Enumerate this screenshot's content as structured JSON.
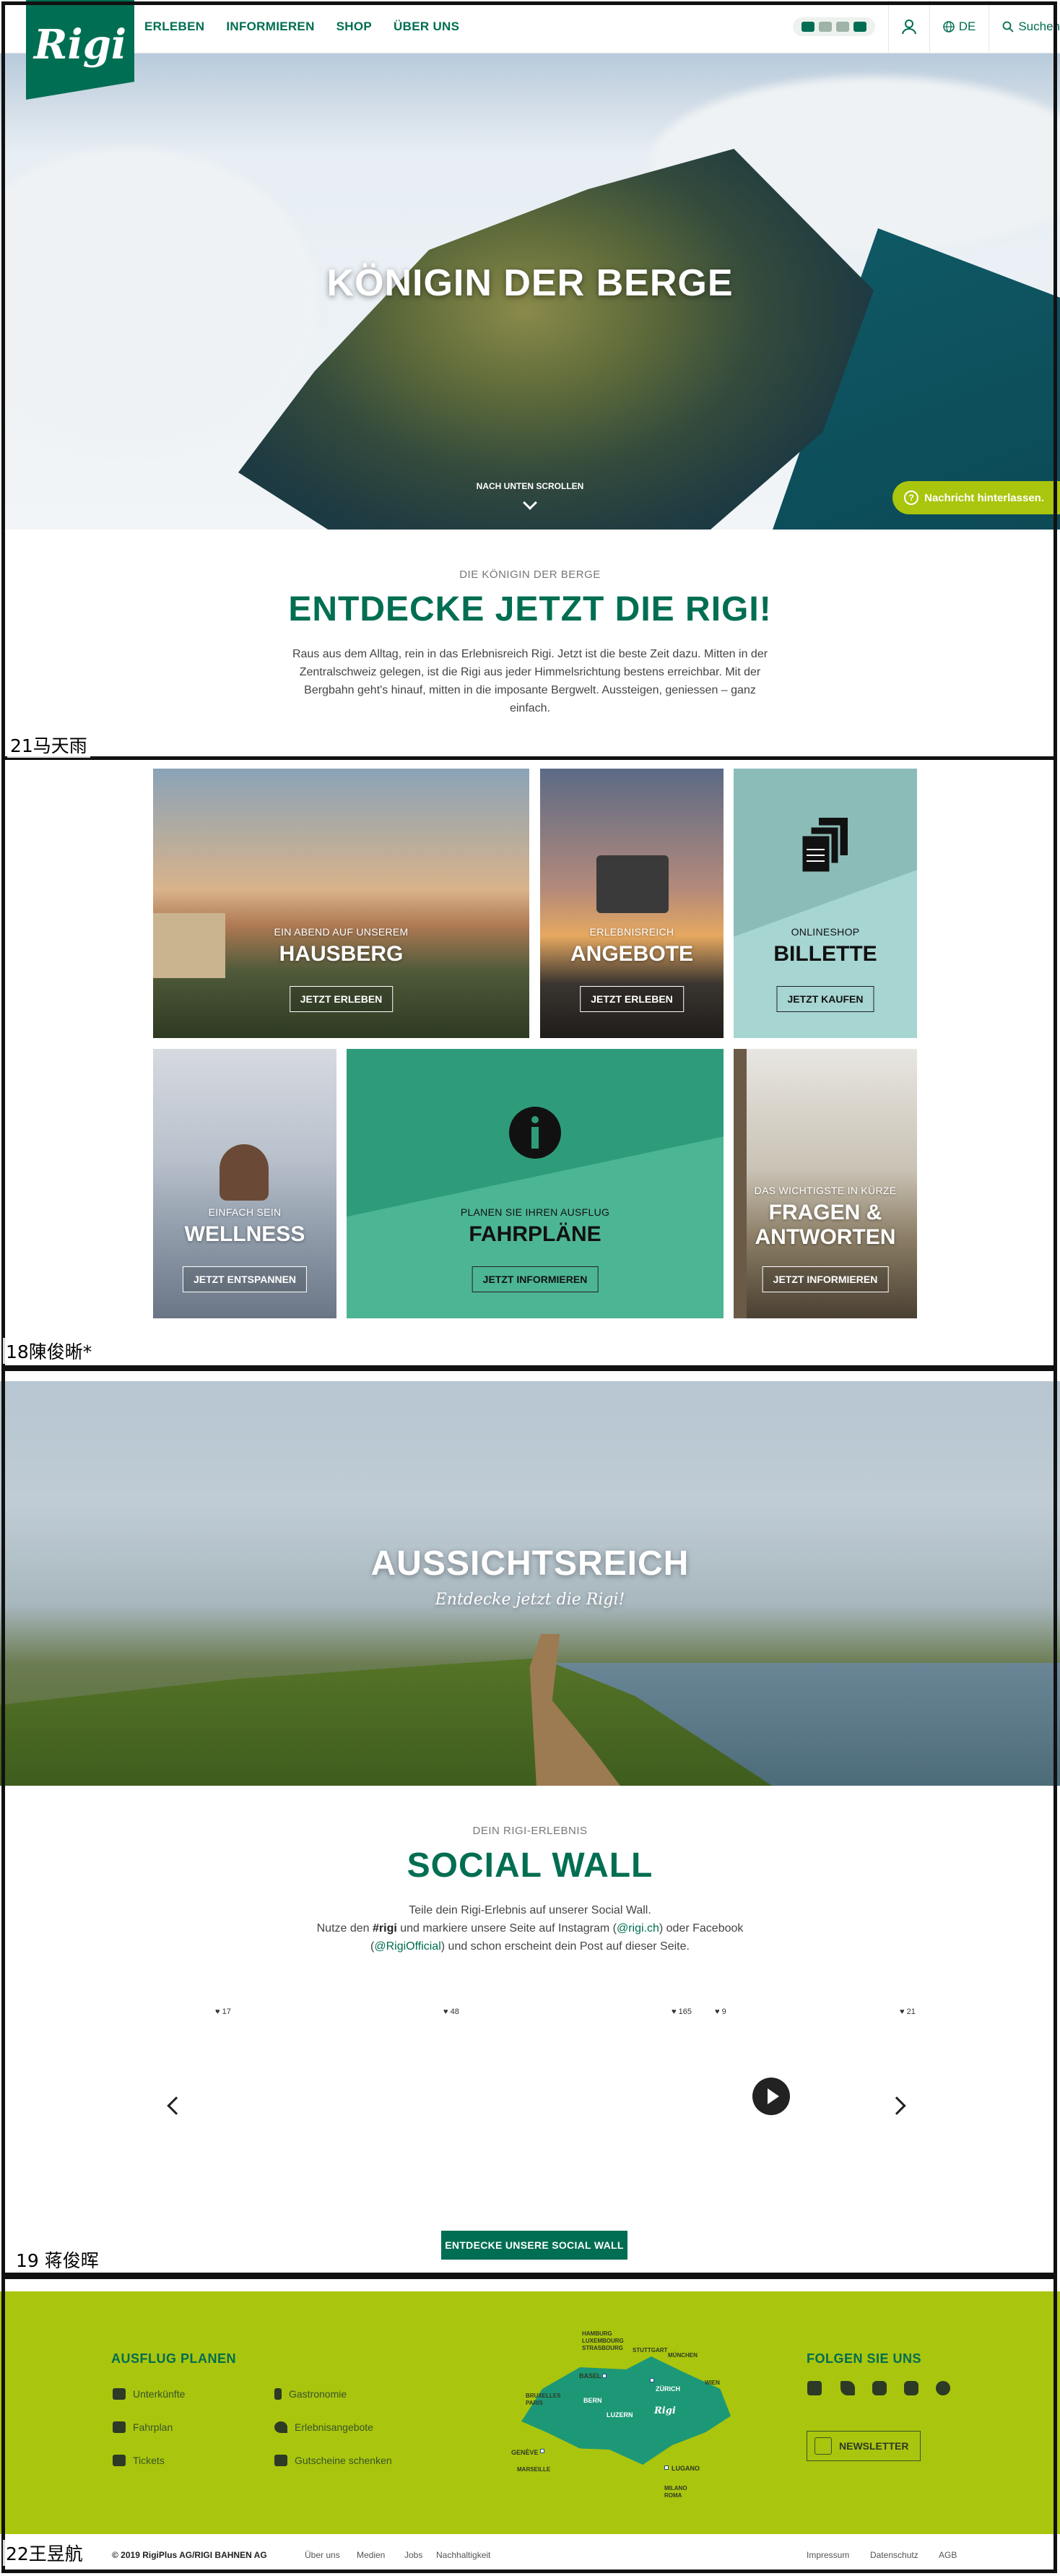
{
  "header": {
    "logo_text": "Rigi",
    "nav": [
      "ERLEBEN",
      "INFORMIEREN",
      "SHOP",
      "ÜBER UNS"
    ],
    "language": "DE",
    "search_label": "Suchen",
    "colors": {
      "brand": "#006e52",
      "lime": "#aac50d"
    }
  },
  "hero": {
    "title": "KÖNIGIN DER BERGE",
    "scroll_hint": "NACH UNTEN SCROLLEN",
    "message_button": "Nachricht hinterlassen."
  },
  "intro": {
    "eyebrow": "DIE KÖNIGIN DER BERGE",
    "title": "ENTDECKE JETZT DIE RIGI!",
    "body": "Raus aus dem Alltag, rein in das Erlebnisreich Rigi. Jetzt ist die beste Zeit dazu. Mitten in der Zentralschweiz gelegen, ist die Rigi aus jeder Himmelsrichtung bestens erreichbar. Mit der Bergbahn geht's hinauf, mitten in die imposante Bergwelt. Aussteigen, geniessen – ganz einfach."
  },
  "tiles": [
    {
      "caption": "EIN ABEND AUF UNSEREM",
      "title": "HAUSBERG",
      "button": "JETZT ERLEBEN"
    },
    {
      "caption": "ERLEBNISREICH",
      "title": "ANGEBOTE",
      "button": "JETZT ERLEBEN"
    },
    {
      "caption": "ONLINESHOP",
      "title": "BILLETTE",
      "button": "JETZT KAUFEN"
    },
    {
      "caption": "EINFACH SEIN",
      "title": "WELLNESS",
      "button": "JETZT ENTSPANNEN"
    },
    {
      "caption": "PLANEN SIE IHREN AUSFLUG",
      "title": "FAHRPLÄNE",
      "button": "JETZT INFORMIEREN"
    },
    {
      "caption": "DAS WICHTIGSTE IN KÜRZE",
      "title": "FRAGEN & ANTWORTEN",
      "button": "JETZT INFORMIEREN"
    }
  ],
  "aussicht": {
    "title": "AUSSICHTSREICH",
    "subtitle": "Entdecke jetzt die Rigi!"
  },
  "social": {
    "eyebrow": "DEIN RIGI-ERLEBNIS",
    "title": "SOCIAL WALL",
    "line1": "Teile dein Rigi-Erlebnis auf unserer Social Wall.",
    "line2_a": "Nutze den ",
    "hashtag": "#rigi",
    "line2_b": " und markiere unsere Seite auf Instagram (",
    "instagram": "@rigi.ch",
    "line2_c": ") oder Facebook",
    "line3_a": "(",
    "facebook": "@RigiOfficial",
    "line3_b": ") und schon erscheint dein Post auf dieser Seite.",
    "likes": [
      "17",
      "48",
      "165",
      "9",
      "21"
    ],
    "cta": "ENTDECKE UNSERE SOCIAL WALL"
  },
  "footer": {
    "plan_heading": "AUSFLUG PLANEN",
    "links_left": [
      "Unterkünfte",
      "Fahrplan",
      "Tickets"
    ],
    "links_right": [
      "Gastronomie",
      "Erlebnisangebote",
      "Gutscheine schenken"
    ],
    "follow_heading": "FOLGEN SIE UNS",
    "newsletter": "NEWSLETTER",
    "map_labels": {
      "hamburg": "HAMBURG",
      "luxembourg": "LUXEMBOURG",
      "strasbourg": "STRASBOURG",
      "stuttgart": "STUTTGART",
      "munchen": "MÜNCHEN",
      "basel": "BASEL",
      "bruxelles": "BRUXELLES",
      "paris": "PARIS",
      "zurich": "ZÜRICH",
      "wien": "WIEN",
      "bern": "BERN",
      "luzern": "LUZERN",
      "rigi": "Rigi",
      "geneve": "GENÈVE",
      "marseille": "MARSEILLE",
      "lugano": "LUGANO",
      "milano": "MILANO",
      "roma": "ROMA"
    },
    "copyright": "© 2019 RigiPlus AG/RIGI BAHNEN AG",
    "bottom_links": [
      "Über uns",
      "Medien",
      "Jobs",
      "Nachhaltigkeit"
    ],
    "legal_links": [
      "Impressum",
      "Datenschutz",
      "AGB"
    ]
  },
  "annotations": [
    "21马天雨",
    "18陳俊晰*",
    "19 蒋俊晖",
    "22王昱航"
  ]
}
